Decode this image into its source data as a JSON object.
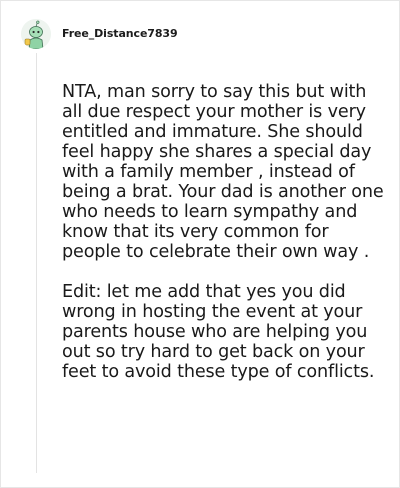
{
  "comment": {
    "username": "Free_Distance7839",
    "avatar_icon": "snoo-avatar-icon",
    "paragraphs": [
      "NTA, man sorry to say this but with all due respect your mother is very entitled and immature. She should feel happy she shares a special day with a family member , instead of being a brat. Your dad is another one who needs to learn sympathy and know that its very common for people to celebrate their own way .",
      "Edit: let me add that yes you did wrong in hosting the event at your parents house who are helping you out so try hard to get back on your feet to avoid these type of conflicts."
    ]
  },
  "colors": {
    "text": "#1a1a1a",
    "avatar_green": "#8fd3a5",
    "border": "#e6e6e6"
  }
}
